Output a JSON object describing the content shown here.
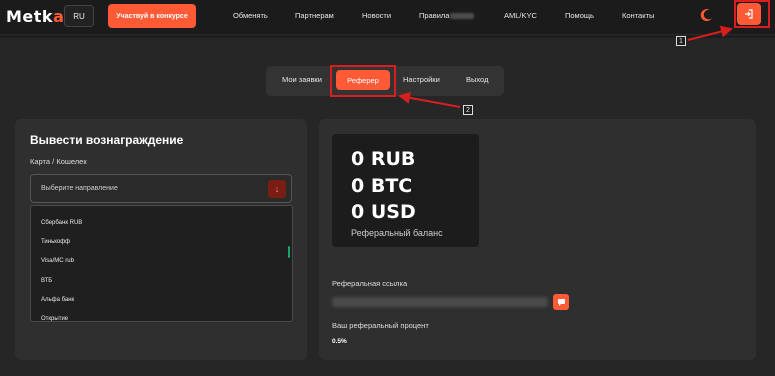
{
  "header": {
    "logo_main": "Metk",
    "logo_accent": "a",
    "lang": "RU",
    "contest_button": "Участвуй в конкурсе",
    "nav": [
      {
        "label": "Обменять"
      },
      {
        "label": "Партнерам"
      },
      {
        "label": "Новости"
      },
      {
        "label": "Правила"
      },
      {
        "label": "AML/KYC"
      },
      {
        "label": "Помощь"
      },
      {
        "label": "Контакты"
      }
    ],
    "theme_icon": "moon-icon",
    "exit_icon": "logout-icon"
  },
  "tabs": [
    {
      "label": "Мои заявки"
    },
    {
      "label": "Реферер",
      "active": true
    },
    {
      "label": "Настройки"
    },
    {
      "label": "Выход"
    }
  ],
  "withdraw": {
    "title": "Вывести вознаграждение",
    "field_label": "Карта / Кошелек",
    "select_placeholder": "Выберите направление",
    "options": [
      "Сбербанк RUB",
      "Тинькофф",
      "Visa/MC rub",
      "ВТБ",
      "Альфа банк",
      "Открытие"
    ]
  },
  "balance": {
    "rub": "0 RUB",
    "btc": "0 BTC",
    "usd": "0 USD",
    "label": "Реферальный баланс"
  },
  "referral": {
    "link_label": "Реферальная ссылка",
    "percent_label": "Ваш реферальный процент",
    "percent_value": "0.5%"
  },
  "annotations": {
    "marker_1": "1",
    "marker_2": "2",
    "highlight_color": "#d81e1e"
  },
  "colors": {
    "accent": "#ff5a36",
    "background": "#1e1e1e",
    "card": "#2f2f2f"
  }
}
